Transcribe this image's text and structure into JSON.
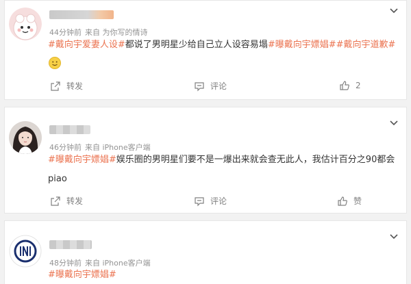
{
  "comments": [
    {
      "time": "44分钟前",
      "source": "来自 为你写的情诗",
      "tags_before": [
        "#戴向宇爱妻人设#"
      ],
      "text": "都说了男明星少给自己立人设容易塌",
      "tags_after": [
        "#曝戴向宇嫖娼#",
        "#戴向宇道歉#"
      ],
      "emoji": "smile-emoji",
      "repost_label": "转发",
      "comment_label": "评论",
      "like_label": "2"
    },
    {
      "time": "46分钟前",
      "source": "来自 iPhone客户端",
      "tag": "#曝戴向宇嫖娼#",
      "text_line1": "娱乐圈的男明星们要不是一爆出来就会查无此人，我估计百分之90都会",
      "text_line2": "piao",
      "repost_label": "转发",
      "comment_label": "评论",
      "like_label": "赞"
    },
    {
      "time": "48分钟前",
      "source": "来自 iPhone客户端",
      "tag": "#曝戴向宇嫖娼#"
    }
  ],
  "colors": {
    "tag": "#eb7350",
    "meta": "#939393",
    "action": "#808080"
  }
}
